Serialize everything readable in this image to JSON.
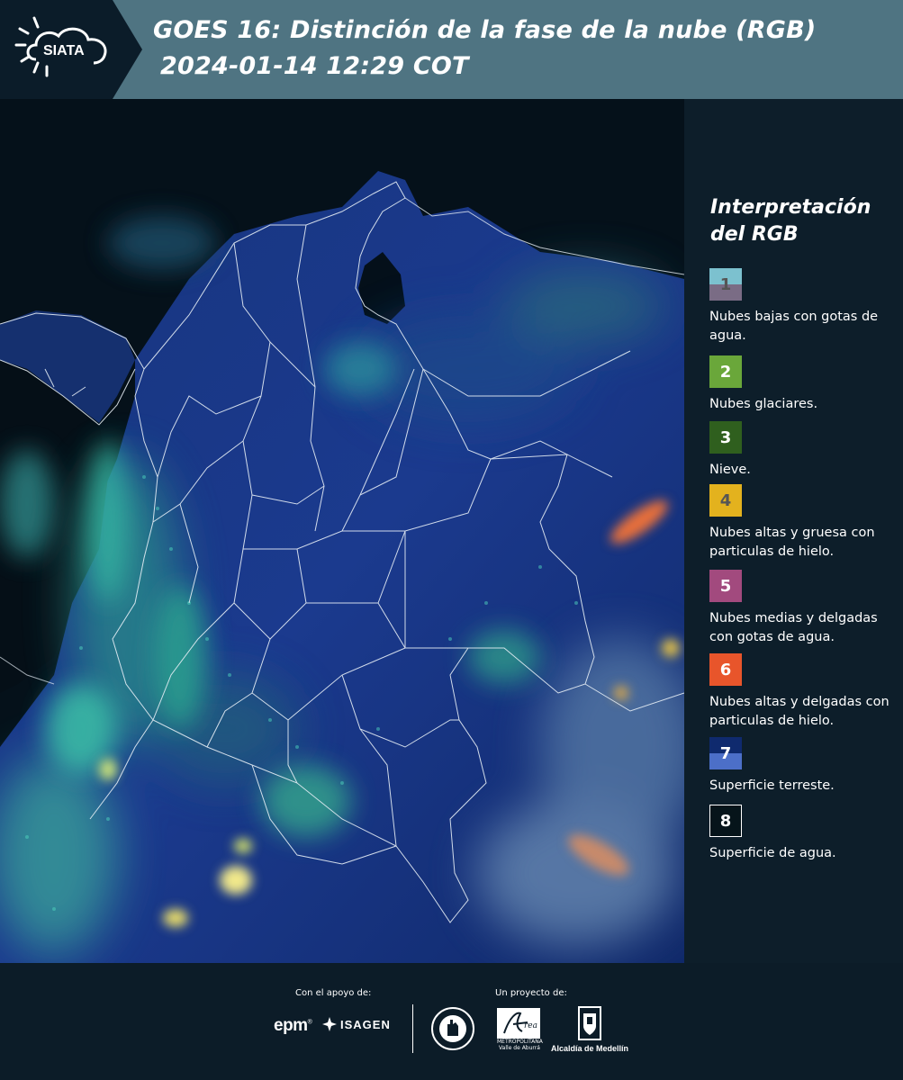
{
  "header": {
    "brand": "SIATA",
    "title_line1": "GOES 16: Distinción de la fase de la nube (RGB)",
    "title_line2": "2024-01-14 12:29 COT"
  },
  "legend": {
    "title": "Interpretación del RGB",
    "items": [
      {
        "number": "1",
        "label": "Nubes bajas con gotas de agua.",
        "color_top": "#7cc1cf",
        "color_bottom": "#7a6c85",
        "text_color": "#555555"
      },
      {
        "number": "2",
        "label": "Nubes glaciares.",
        "color_top": "#6aa73a",
        "color_bottom": "#6aa73a",
        "text_color": "#ffffff"
      },
      {
        "number": "3",
        "label": "Nieve.",
        "color_top": "#2f5f1e",
        "color_bottom": "#2f5f1e",
        "text_color": "#ffffff"
      },
      {
        "number": "4",
        "label": "Nubes altas y gruesa con particulas de hielo.",
        "color_top": "#e3b21e",
        "color_bottom": "#e3b21e",
        "text_color": "#555555"
      },
      {
        "number": "5",
        "label": "Nubes medias y delgadas con gotas de agua.",
        "color_top": "#a24a7e",
        "color_bottom": "#a24a7e",
        "text_color": "#ffffff"
      },
      {
        "number": "6",
        "label": "Nubes altas y delgadas con particulas de hielo.",
        "color_top": "#e8552b",
        "color_bottom": "#e8552b",
        "text_color": "#ffffff"
      },
      {
        "number": "7",
        "label": "Superficie terreste.",
        "color_top": "#0f2a6e",
        "color_bottom": "#4c6fc8",
        "text_color": "#ffffff"
      },
      {
        "number": "8",
        "label": "Superficie de agua.",
        "color_top": "#06141a",
        "color_bottom": "#06141a",
        "text_color": "#ffffff"
      }
    ]
  },
  "footer": {
    "support_label": "Con el apoyo de:",
    "project_label": "Un proyecto de:",
    "epm": "epm",
    "epm_mark": "®",
    "isagen": "ISAGEN",
    "amva": "METROPOLITANA Valle de Aburrá",
    "alcaldia": "Alcaldía de Medellín"
  }
}
